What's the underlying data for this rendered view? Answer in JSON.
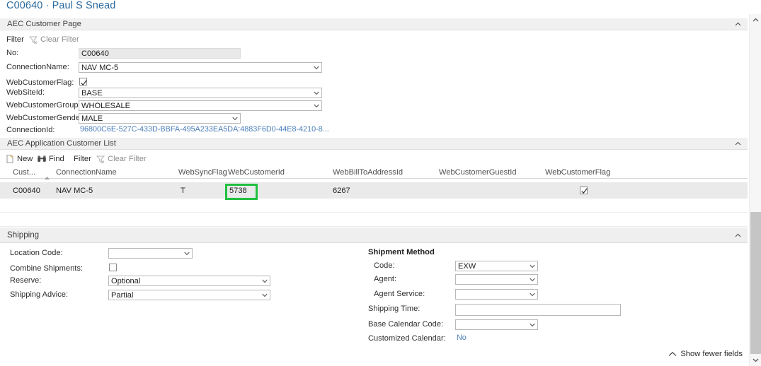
{
  "page": {
    "title": "C00640 · Paul S Snead"
  },
  "sections": {
    "customer_page": {
      "title": "AEC Customer Page",
      "collapse_icon": "chevron-up-icon",
      "toolbar": [
        {
          "label": "Filter",
          "icon": null,
          "dim": false
        },
        {
          "label": "Clear Filter",
          "icon": "clear-filter-icon",
          "dim": true
        }
      ],
      "fields": [
        {
          "label": "No:",
          "value": "C00640",
          "type": "text-readonly"
        },
        {
          "label": "ConnectionName:",
          "value": "NAV MC-5",
          "type": "dropdown"
        },
        {
          "label": "WebCustomerFlag:",
          "value": "checked",
          "type": "checkbox"
        },
        {
          "label": "WebSiteId:",
          "value": "BASE",
          "type": "dropdown"
        },
        {
          "label": "WebCustomerGroup:",
          "value": "WHOLESALE",
          "type": "dropdown"
        },
        {
          "label": "WebCustomerGender:",
          "value": "MALE",
          "type": "dropdown"
        },
        {
          "label": "ConnectionId:",
          "value": "96800C6E-527C-433D-BBFA-495A233EA5DA:4883F6D0-44E8-4210-8...",
          "type": "link"
        }
      ]
    },
    "customer_list": {
      "title": "AEC Application Customer List",
      "collapse_icon": "chevron-up-icon",
      "toolbar": [
        {
          "label": "New",
          "icon": "new-document-icon",
          "dim": false
        },
        {
          "label": "Find",
          "icon": "binoculars-icon",
          "dim": false
        },
        {
          "label": "Filter",
          "icon": null,
          "dim": false
        },
        {
          "label": "Clear Filter",
          "icon": "clear-filter-icon",
          "dim": true
        }
      ],
      "columns": [
        {
          "header": "Cust...",
          "sorted": "asc"
        },
        {
          "header": "ConnectionName",
          "sorted": null
        },
        {
          "header": "WebSyncFlag",
          "sorted": null
        },
        {
          "header": "WebCustomerId",
          "sorted": null
        },
        {
          "header": "WebBillToAddressId",
          "sorted": null
        },
        {
          "header": "WebCustomerGuestId",
          "sorted": null
        },
        {
          "header": "WebCustomerFlag",
          "sorted": null
        }
      ],
      "rows": [
        {
          "cust": "C00640",
          "connection_name": "NAV MC-5",
          "web_sync_flag": "T",
          "web_customer_id": "5738",
          "web_bill_to_address_id": "6267",
          "web_customer_guest_id": "",
          "web_customer_flag": "checked",
          "selected": true,
          "highlight_cell": "web_customer_id"
        }
      ],
      "highlight_color": "#22c040"
    },
    "shipping": {
      "title": "Shipping",
      "collapse_icon": "chevron-up-icon",
      "left_fields": [
        {
          "label": "Location Code:",
          "value": "",
          "type": "dropdown"
        },
        {
          "label": "Combine Shipments:",
          "value": "unchecked",
          "type": "checkbox"
        },
        {
          "label": "Reserve:",
          "value": "Optional",
          "type": "dropdown"
        },
        {
          "label": "Shipping Advice:",
          "value": "Partial",
          "type": "dropdown"
        }
      ],
      "right_group_title": "Shipment Method",
      "right_fields": [
        {
          "label": "Code:",
          "value": "EXW",
          "type": "dropdown"
        },
        {
          "label": "Agent:",
          "value": "",
          "type": "dropdown"
        },
        {
          "label": "Agent Service:",
          "value": "",
          "type": "dropdown"
        },
        {
          "label": "Shipping Time:",
          "value": "",
          "type": "text"
        },
        {
          "label": "Base Calendar Code:",
          "value": "",
          "type": "dropdown"
        },
        {
          "label": "Customized Calendar:",
          "value": "No",
          "type": "link"
        }
      ]
    }
  },
  "footer": {
    "show_fewer_label": "Show fewer fields",
    "show_fewer_icon": "chevron-up-icon"
  },
  "scrollbar": {
    "up_icon": "chevron-up-icon",
    "down_icon": "chevron-down-icon"
  },
  "colors": {
    "title_link": "#2a6a9e",
    "section_bg": "#f0f0f0",
    "highlight_green": "#22c040",
    "link_blue": "#4a7ebb",
    "row_selected": "#eaeaea"
  }
}
